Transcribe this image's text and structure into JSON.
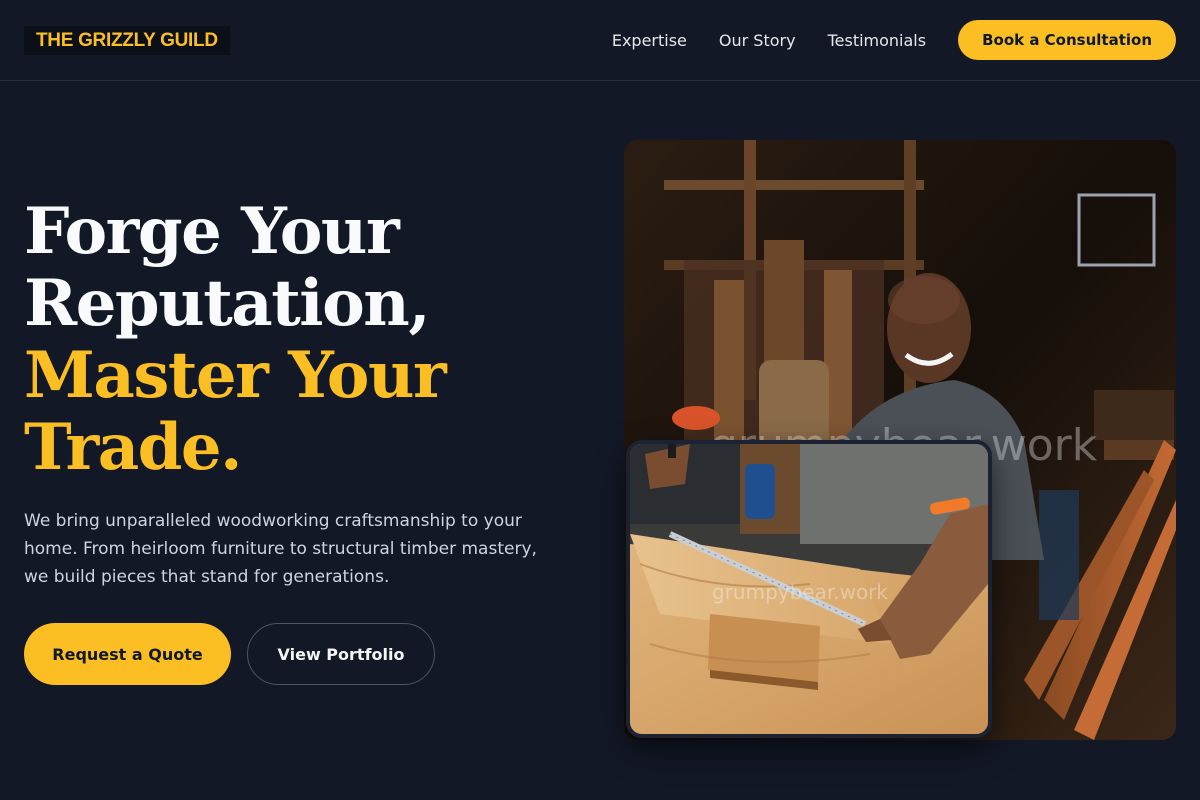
{
  "header": {
    "logo": "THE GRIZZLY GUILD",
    "nav": [
      {
        "label": "Expertise"
      },
      {
        "label": "Our Story"
      },
      {
        "label": "Testimonials"
      }
    ],
    "cta_label": "Book a Consultation"
  },
  "hero": {
    "title_line1": "Forge Your",
    "title_line2": "Reputation,",
    "title_line3": "Master Your",
    "title_line4": "Trade.",
    "description": "We bring unparalleled woodworking craftsmanship to your home. From heirloom furniture to structural timber mastery, we build pieces that stand for generations.",
    "primary_button": "Request a Quote",
    "secondary_button": "View Portfolio"
  },
  "images": {
    "main_watermark": "grumpybear.work",
    "inset_watermark": "grumpybear.work"
  },
  "colors": {
    "background": "#121826",
    "accent": "#fbbf24",
    "text": "#f9fafb"
  }
}
